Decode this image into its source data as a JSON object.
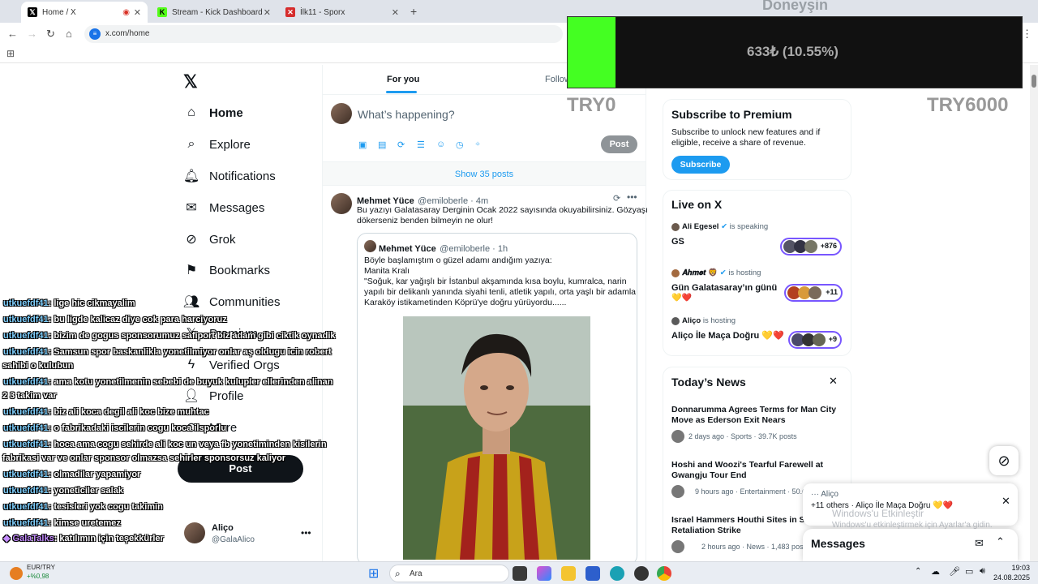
{
  "browser": {
    "tabs": [
      {
        "title": "Home / X",
        "active": true
      },
      {
        "title": "Stream - Kick Dashboard",
        "active": false
      },
      {
        "title": "İlk11 - Sporx",
        "active": false
      }
    ],
    "url": "x.com/home"
  },
  "overlay": {
    "donation_title": "Doneyşin",
    "donation_amount": "633₺ (10.55%)",
    "donation_progress": 0.1055,
    "min_label": "TRY0",
    "max_label": "TRY6000",
    "chat": [
      {
        "user": "utkuefdf41",
        "text": ": lige hic cikmayalim"
      },
      {
        "user": "utkuefdf41",
        "text": ": bu ligde kalicaz diye cok para harciyoruz"
      },
      {
        "user": "utkuefdf41",
        "text": ": bizim de gogus sponsorumuz safiport biz adam gibi ciktik oynadik"
      },
      {
        "user": "utkuefdf41",
        "text": ": Samsun spor baskanlikla yonetilmiyor onlar aş oldugu icin robert",
        "cont": "sahibi o kulubun"
      },
      {
        "user": "utkuefdf41",
        "text": ": ama kotu yonetilmenin sebebi de buyuk kulupler ellerinden alinan",
        "cont": "2 3 takim var"
      },
      {
        "user": "utkuefdf41",
        "text": ": biz ali koca degil ali koc bize muhtac"
      },
      {
        "user": "utkuefdf41",
        "text": ": o fabrikadaki iscilerin cogu koca ilsporlu"
      },
      {
        "user": "utkuefdf41",
        "text": ": hoca ama cogu sehirde ali koc un veya fb yonetiminden kisilerin",
        "cont": "fabrikasi var ve onlar sponsor olmazsa sehirler sponsorsuz kaliyor"
      },
      {
        "user": "utkuefdf41",
        "text": ": olmadilar yapamiyor"
      },
      {
        "user": "utkuefdf41",
        "text": ": yoneticiler salak"
      },
      {
        "user": "utkuefdf41",
        "text": ": tesisleri yok cogu takimin"
      },
      {
        "user": "utkuefdf41",
        "text": ": kimse uretemez"
      },
      {
        "user": "GalaTalks",
        "text": ": katılımın için teşekkürler"
      }
    ]
  },
  "nav": {
    "items": [
      {
        "label": "Home"
      },
      {
        "label": "Explore"
      },
      {
        "label": "Notifications"
      },
      {
        "label": "Messages"
      },
      {
        "label": "Grok"
      },
      {
        "label": "Bookmarks"
      },
      {
        "label": "Communities"
      },
      {
        "label": "Premium"
      },
      {
        "label": "Verified Orgs"
      },
      {
        "label": "Profile"
      },
      {
        "label": "More"
      }
    ],
    "post_label": "Post",
    "account_name": "Aliço",
    "account_handle": "@GalaAlico"
  },
  "feed": {
    "tab_for_you": "For you",
    "tab_following": "Following",
    "composer_placeholder": "What’s happening?",
    "composer_post": "Post",
    "show_posts": "Show 35 posts",
    "tweet": {
      "name": "Mehmet Yüce",
      "handle": "@emiloberle · 4m",
      "text1": "Bu yazıyı Galatasaray Derginin Ocak 2022 sayısında okuyabilirsiniz. Gözyaşı",
      "text2": "dökerseniz benden bilmeyin ne olur!",
      "quote_name": "Mehmet Yüce",
      "quote_handle": "@emiloberle · 1h",
      "q1": "Böyle başlamıştım o güzel adamı andığım yazıya:",
      "q2": "Manita Kralı",
      "q3": "\"Soğuk, kar yağışlı bir İstanbul akşamında kısa boylu, kumralca, narin",
      "q4": "yapılı bir delikanlı yanında siyahi tenli, atletik yapılı, orta yaşlı bir adamla",
      "q5": "Karaköy istikametinden Köprü'ye doğru yürüyordu......"
    }
  },
  "right": {
    "premium_title": "Subscribe to Premium",
    "premium_text1": "Subscribe to unlock new features and if",
    "premium_text2": "eligible, receive a share of revenue.",
    "premium_button": "Subscribe",
    "live_title": "Live on X",
    "live": [
      {
        "host": "Ali Egesel",
        "status": "is speaking",
        "title": "GS",
        "count": "+876"
      },
      {
        "host": "𝑨𝒉𝒎𝒆𝒕 🦁",
        "status": "is hosting",
        "title": "Gün Galatasaray’ın günü",
        "title2": "💛❤️",
        "count": "+11"
      },
      {
        "host": "Aliço",
        "status": "is hosting",
        "title": "Aliço İle Maça Doğru 💛❤️",
        "count": "+9"
      }
    ],
    "news_title": "Today’s News",
    "news": [
      {
        "t1": "Donnarumma Agrees Terms for Man City",
        "t2": "Move as Ederson Exit Nears",
        "meta": "2 days ago · Sports · 39.7K posts"
      },
      {
        "t1": "Hoshi and Woozi's Tearful Farewell at",
        "t2": "Gwangju Tour End",
        "meta": "9 hours ago · Entertainment · 50.6"
      },
      {
        "t1": "Israel Hammers Houthi Sites in Sanaa",
        "t2": "Retaliation Strike",
        "meta": "2 hours ago · News · 1,483 posts"
      }
    ]
  },
  "popup": {
    "line1": "··· Aliço",
    "line2": "+11 others · Aliço İle Maça Doğru 💛❤️",
    "messages_title": "Messages"
  },
  "windows": {
    "activate1": "Windows'u Etkinleştir",
    "activate2": "Windows'u etkinleştirmek için Ayarlar'a gidin.",
    "ticker_name": "EUR/TRY",
    "ticker_change": "+%0,98",
    "search": "Ara",
    "time": "19:03",
    "date": "24.08.2025"
  },
  "colors": {
    "accent": "#1d9bf0",
    "donation_bar": "#44ff22",
    "live_ring": "#7856ff"
  }
}
